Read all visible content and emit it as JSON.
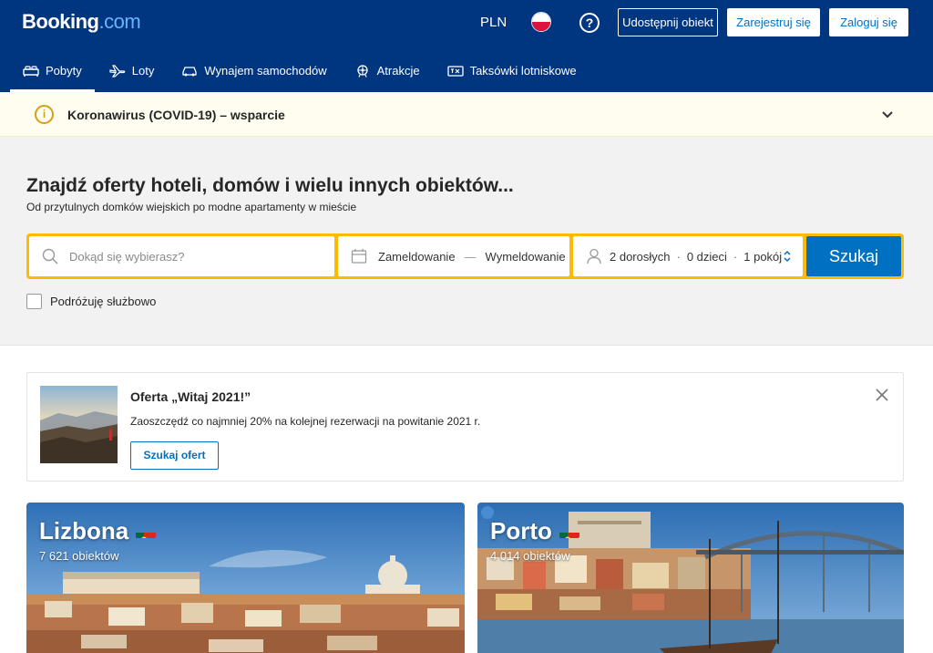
{
  "header": {
    "logo_main": "Booking",
    "logo_suffix": ".com",
    "currency": "PLN",
    "help_symbol": "?",
    "list_property_label": "Udostępnij obiekt",
    "register_label": "Zarejestruj się",
    "login_label": "Zaloguj się"
  },
  "nav": {
    "items": [
      {
        "label": "Pobyty",
        "icon": "bed-icon",
        "active": true
      },
      {
        "label": "Loty",
        "icon": "plane-icon"
      },
      {
        "label": "Wynajem samochodów",
        "icon": "car-icon"
      },
      {
        "label": "Atrakcje",
        "icon": "attractions-icon"
      },
      {
        "label": "Taksówki lotniskowe",
        "icon": "taxi-icon"
      }
    ]
  },
  "covid": {
    "icon_symbol": "i",
    "text": "Koronawirus (COVID-19) – wsparcie"
  },
  "search": {
    "title": "Znajdź oferty hoteli, domów i wielu innych obiektów...",
    "subtitle": "Od przytulnych domków wiejskich po modne apartamenty w mieście",
    "destination_placeholder": "Dokąd się wybierasz?",
    "checkin_label": "Zameldowanie",
    "date_separator": "—",
    "checkout_label": "Wymeldowanie",
    "adults": "2 dorosłych",
    "children": "0 dzieci",
    "rooms": "1 pokój",
    "guest_separator": "·",
    "search_button": "Szukaj",
    "business_travel_label": "Podróżuję służbowo"
  },
  "offer": {
    "title": "Oferta „Witaj 2021!”",
    "description": "Zaoszczędź co najmniej 20% na kolejnej rezerwacji na powitanie 2021 r.",
    "button": "Szukaj ofert"
  },
  "destinations": [
    {
      "name": "Lizbona",
      "count": "7 621 obiektów"
    },
    {
      "name": "Porto",
      "count": "4 014 obiektów"
    }
  ],
  "colors": {
    "brand": "#003580",
    "accent": "#0071c2",
    "search_border": "#febb02"
  }
}
